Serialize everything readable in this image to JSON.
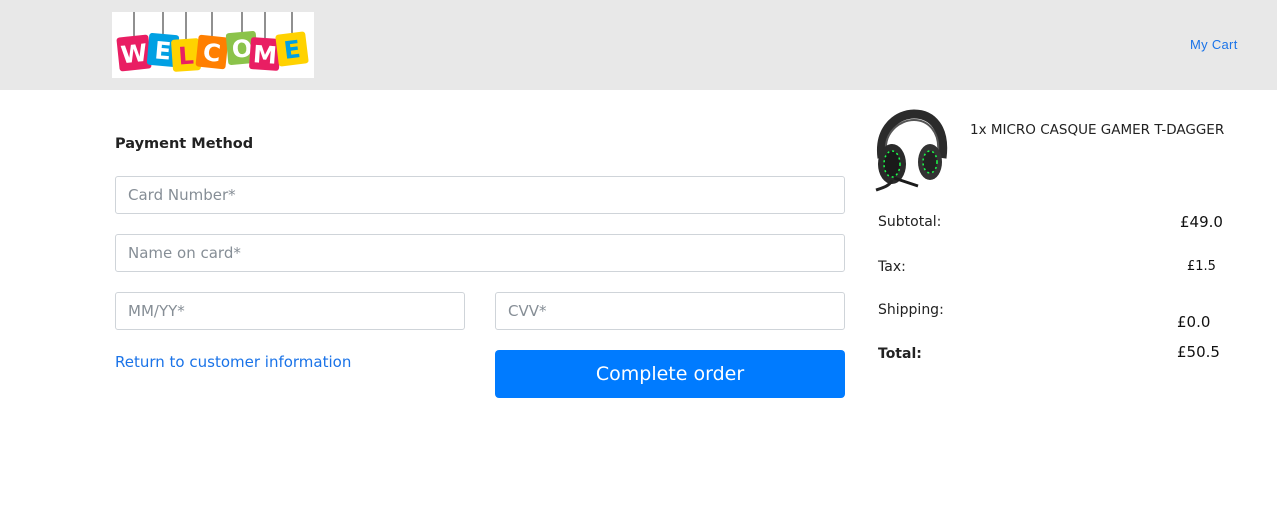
{
  "header": {
    "logo_text": "WELCOME",
    "cart_link": "My Cart"
  },
  "payment": {
    "title": "Payment Method",
    "card_number_placeholder": "Card Number*",
    "name_on_card_placeholder": "Name on card*",
    "expiry_placeholder": "MM/YY*",
    "cvv_placeholder": "CVV*",
    "return_link": "Return to customer information",
    "complete_button": "Complete order"
  },
  "order": {
    "item": "1x MICRO CASQUE GAMER T-DAGGER",
    "subtotal_label": "Subtotal:",
    "subtotal_value": "£49.0",
    "tax_label": "Tax:",
    "tax_value": "£1.5",
    "shipping_label": "Shipping:",
    "shipping_value": "£0.0",
    "total_label": "Total:",
    "total_value": "£50.5"
  },
  "colors": {
    "accent": "#007bff",
    "link": "#1a73e8",
    "header_bg": "#e8e8e8"
  }
}
